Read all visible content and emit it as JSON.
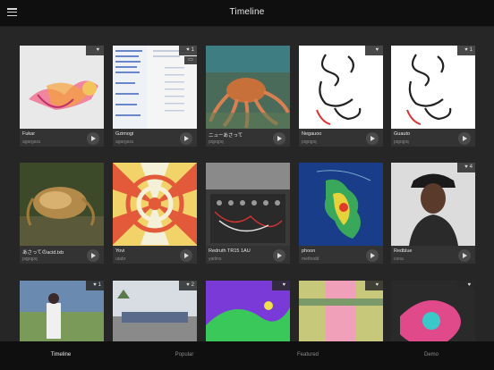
{
  "header": {
    "title": "Timeline"
  },
  "cards": [
    {
      "title": "Fukar",
      "user": "agargara",
      "likes": "",
      "icon": "image-icon"
    },
    {
      "title": "Gzimogi",
      "user": "agargara",
      "likes": "1",
      "comments": "1",
      "icon": "image-icon"
    },
    {
      "title": "ニューあさって",
      "user": "pqpqpq",
      "likes": "",
      "icon": "image-icon"
    },
    {
      "title": "Negauoo",
      "user": "pqpqpq",
      "likes": "",
      "icon": "image-icon"
    },
    {
      "title": "Guauto",
      "user": "pqpqpq",
      "likes": "1",
      "icon": "image-icon"
    },
    {
      "title": "あさってのacid.txb",
      "user": "pqpqpq",
      "likes": "",
      "icon": "image-icon"
    },
    {
      "title": "Yovi",
      "user": "utabr",
      "likes": "",
      "icon": "image-icon"
    },
    {
      "title": "Redruth TR15 1AU",
      "user": "yarlins",
      "likes": "",
      "icon": "image-icon"
    },
    {
      "title": "phoon",
      "user": "methodd",
      "likes": "",
      "icon": "image-icon"
    },
    {
      "title": "Redblue",
      "user": "cona",
      "likes": "4",
      "icon": "image-icon"
    },
    {
      "title": "",
      "user": "",
      "likes": "1",
      "icon": "image-icon"
    },
    {
      "title": "",
      "user": "",
      "likes": "2",
      "icon": "image-icon"
    },
    {
      "title": "",
      "user": "",
      "likes": "",
      "icon": "image-icon"
    },
    {
      "title": "",
      "user": "",
      "likes": "",
      "icon": "image-icon"
    },
    {
      "title": "",
      "user": "",
      "likes": "",
      "icon": "image-icon"
    }
  ],
  "tabs": [
    {
      "label": "Timeline",
      "active": true
    },
    {
      "label": "Popular",
      "active": false
    },
    {
      "label": "Featured",
      "active": false
    },
    {
      "label": "Demo",
      "active": false
    }
  ]
}
